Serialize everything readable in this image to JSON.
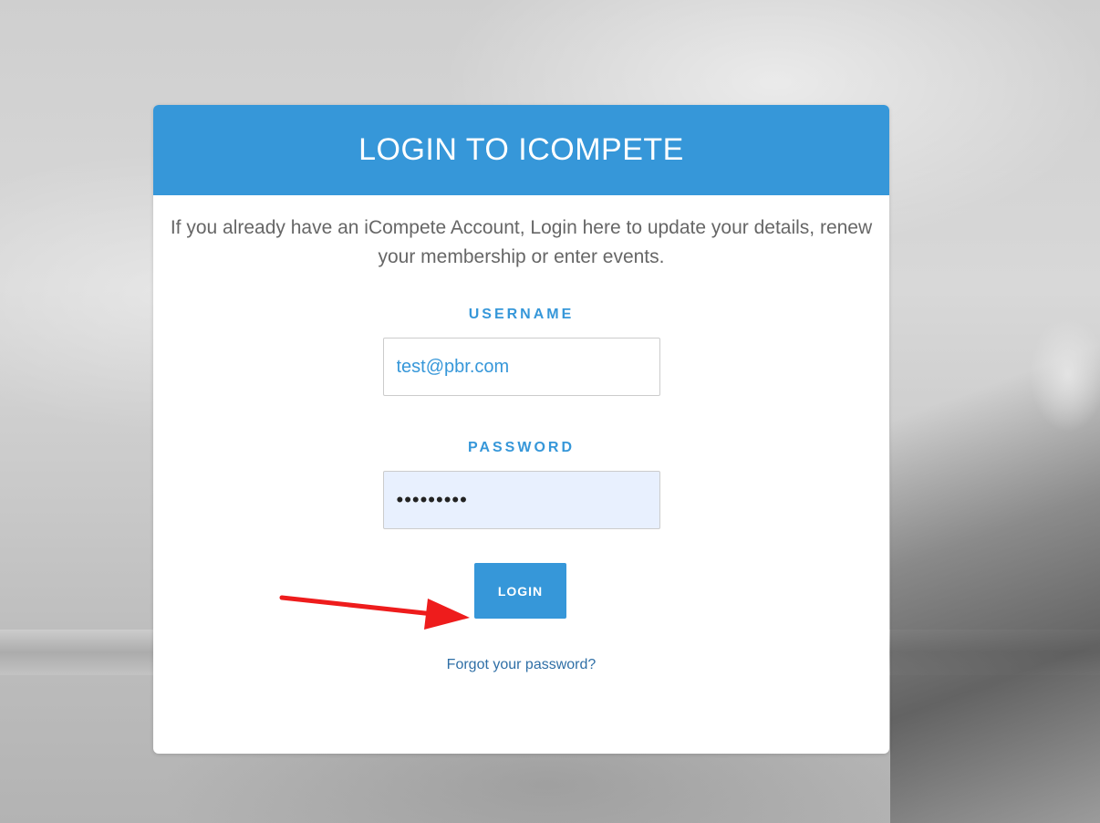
{
  "login_card": {
    "title": "LOGIN TO ICOMPETE",
    "intro": "If you already have an iCompete Account, Login here to update your details, renew your membership or enter events.",
    "username": {
      "label": "USERNAME",
      "value": "test@pbr.com"
    },
    "password": {
      "label": "PASSWORD",
      "value": "•••••••••"
    },
    "login_button": "LOGIN",
    "forgot_link": "Forgot your password?"
  },
  "annotation": {
    "arrow_color": "#ee1c1c",
    "arrow_icon": "red-arrow-icon"
  },
  "colors": {
    "accent": "#3697d9",
    "link": "#2f6fa6"
  }
}
